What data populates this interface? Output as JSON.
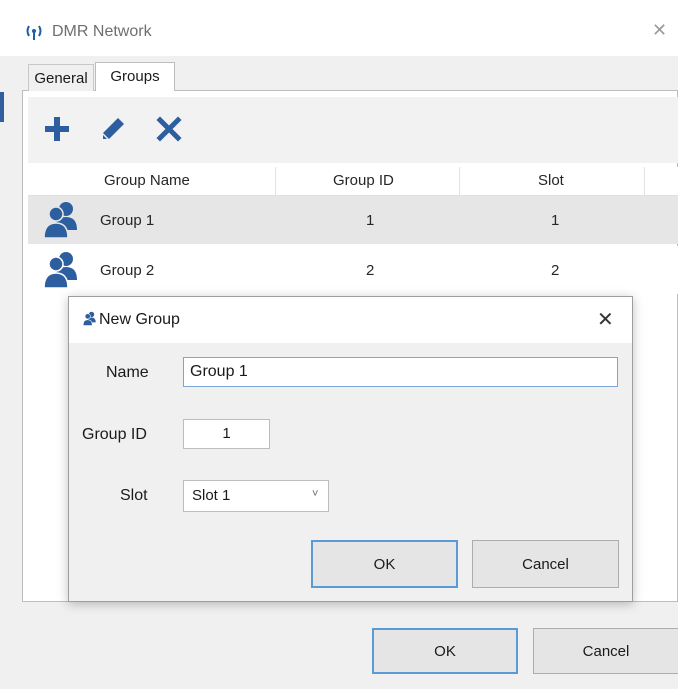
{
  "window": {
    "title": "DMR Network",
    "close_symbol": "✕",
    "app_icon_symbol": "(ψ)"
  },
  "tabs": [
    {
      "label": "General",
      "active": false
    },
    {
      "label": "Groups",
      "active": true
    }
  ],
  "toolbar": {
    "add_icon": "plus-icon",
    "edit_icon": "pencil-icon",
    "delete_icon": "delete-x-icon",
    "icon_color": "#2d5fa0"
  },
  "list": {
    "columns": [
      "Group Name",
      "Group ID",
      "Slot"
    ],
    "rows": [
      {
        "name": "Group 1",
        "group_id": "1",
        "slot": "1",
        "selected": true
      },
      {
        "name": "Group 2",
        "group_id": "2",
        "slot": "2",
        "selected": false
      }
    ]
  },
  "footer": {
    "ok_label": "OK",
    "cancel_label": "Cancel"
  },
  "dialog": {
    "title": "New Group",
    "close_symbol": "✕",
    "name_label": "Name",
    "name_value": "Group 1",
    "group_id_label": "Group ID",
    "group_id_value": "1",
    "slot_label": "Slot",
    "slot_value": "Slot 1",
    "slot_caret": "˅",
    "ok_label": "OK",
    "cancel_label": "Cancel"
  }
}
